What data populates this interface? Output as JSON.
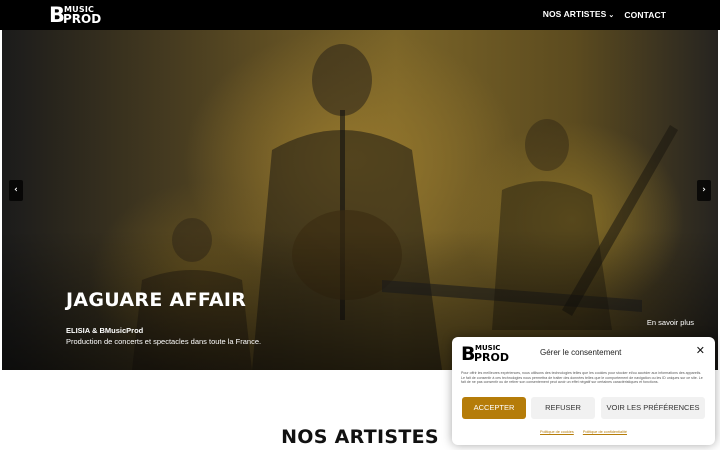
{
  "header": {
    "logo": {
      "letter": "B",
      "top": "MUSIC",
      "bottom": "PROD"
    },
    "nav": {
      "artists": "NOS ARTISTES",
      "contact": "CONTACT"
    },
    "chevron": "⌄"
  },
  "hero": {
    "title": "JAGUARE AFFAIR",
    "subtitle": "ELISIA & BMusicProd",
    "description": "Production de concerts et spectacles dans toute la France.",
    "more": "En savoir plus",
    "prev": "‹",
    "next": "›"
  },
  "section": {
    "title": "NOS ARTISTES"
  },
  "consent": {
    "logo": {
      "letter": "B",
      "top": "MUSIC",
      "bottom": "PROD"
    },
    "title": "Gérer le consentement",
    "close": "✕",
    "body": "Pour offrir les meilleures expériences, nous utilisons des technologies telles que les cookies pour stocker et/ou accéder aux informations des appareils. Le fait de consentir à ces technologies nous permettra de traiter des données telles que le comportement de navigation ou les ID uniques sur ce site. Le fait de ne pas consentir ou de retirer son consentement peut avoir un effet négatif sur certaines caractéristiques et fonctions.",
    "accept": "ACCEPTER",
    "refuse": "REFUSER",
    "prefs": "VOIR LES PRÉFÉRENCES",
    "links": {
      "cookies": "Politique de cookies",
      "privacy": "Politique de confidentialité"
    }
  },
  "colors": {
    "accent": "#b57c09",
    "header": "#000000"
  }
}
